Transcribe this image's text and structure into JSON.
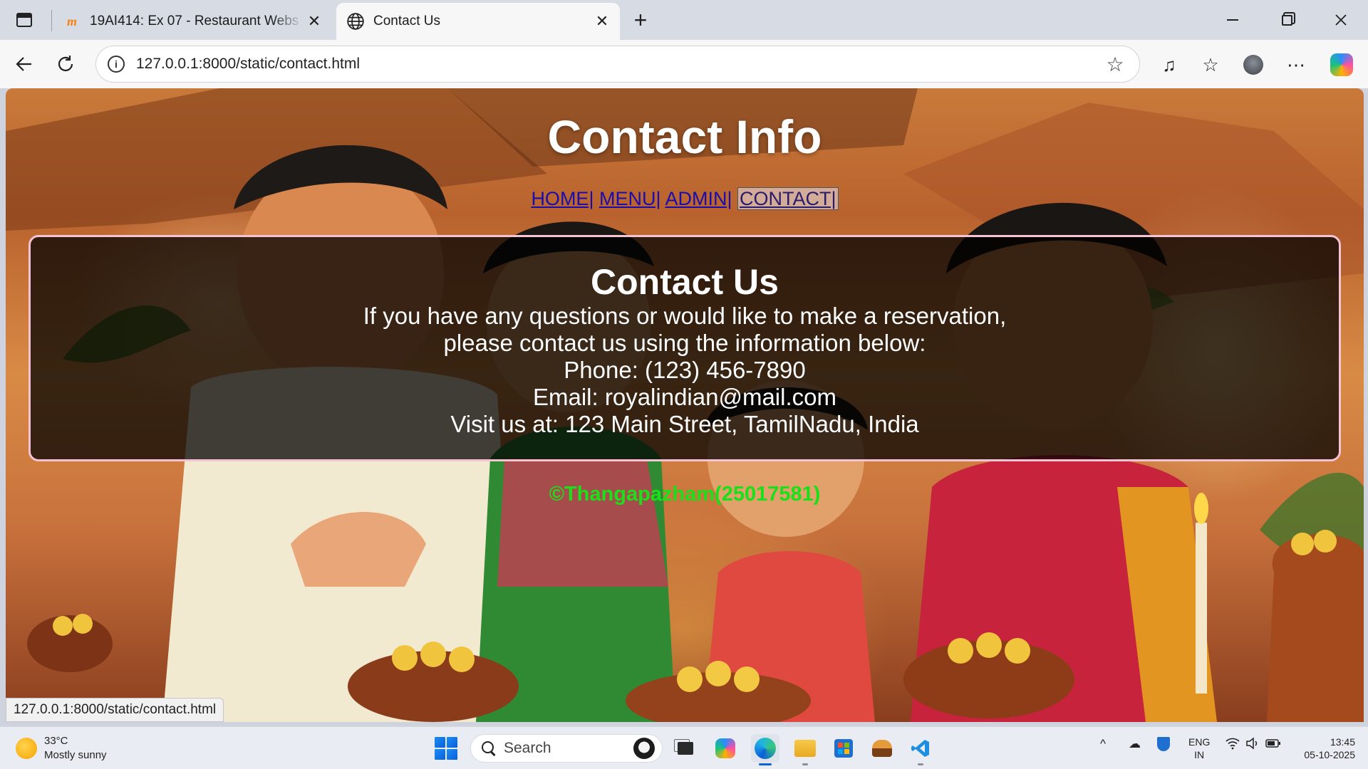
{
  "browser": {
    "tabs": [
      {
        "title": "19AI414: Ex 07 - Restaurant Webs",
        "favicon": "moodle-icon",
        "active": false
      },
      {
        "title": "Contact Us",
        "favicon": "globe-icon",
        "active": true
      }
    ],
    "close_glyph": "✕",
    "new_tab_glyph": "+",
    "url": "127.0.0.1:8000/static/contact.html",
    "status_url": "127.0.0.1:8000/static/contact.html"
  },
  "page": {
    "title": "Contact Info",
    "nav": [
      {
        "label": "HOME|",
        "current": false
      },
      {
        "label": "MENU|",
        "current": false
      },
      {
        "label": "ADMIN|",
        "current": false
      },
      {
        "label": "CONTACT|",
        "current": true
      }
    ],
    "contact": {
      "heading": "Contact Us",
      "lines": [
        "If you have any questions or would like to make a reservation,",
        "please contact us using the information below:",
        "Phone: (123) 456-7890",
        "Email: royalindian@mail.com",
        "Visit us at: 123 Main Street, TamilNadu, India"
      ]
    },
    "copyright": "©Thangapazham(25017581)"
  },
  "taskbar": {
    "weather": {
      "temp": "33°C",
      "condition": "Mostly sunny"
    },
    "search_label": "Search",
    "lang": {
      "line1": "ENG",
      "line2": "IN"
    },
    "clock": {
      "time": "13:45",
      "date": "05-10-2025"
    }
  },
  "colors": {
    "copyright": "#19e019",
    "contact_border": "#f5c3d3",
    "nav_link": "#1a0dab"
  }
}
